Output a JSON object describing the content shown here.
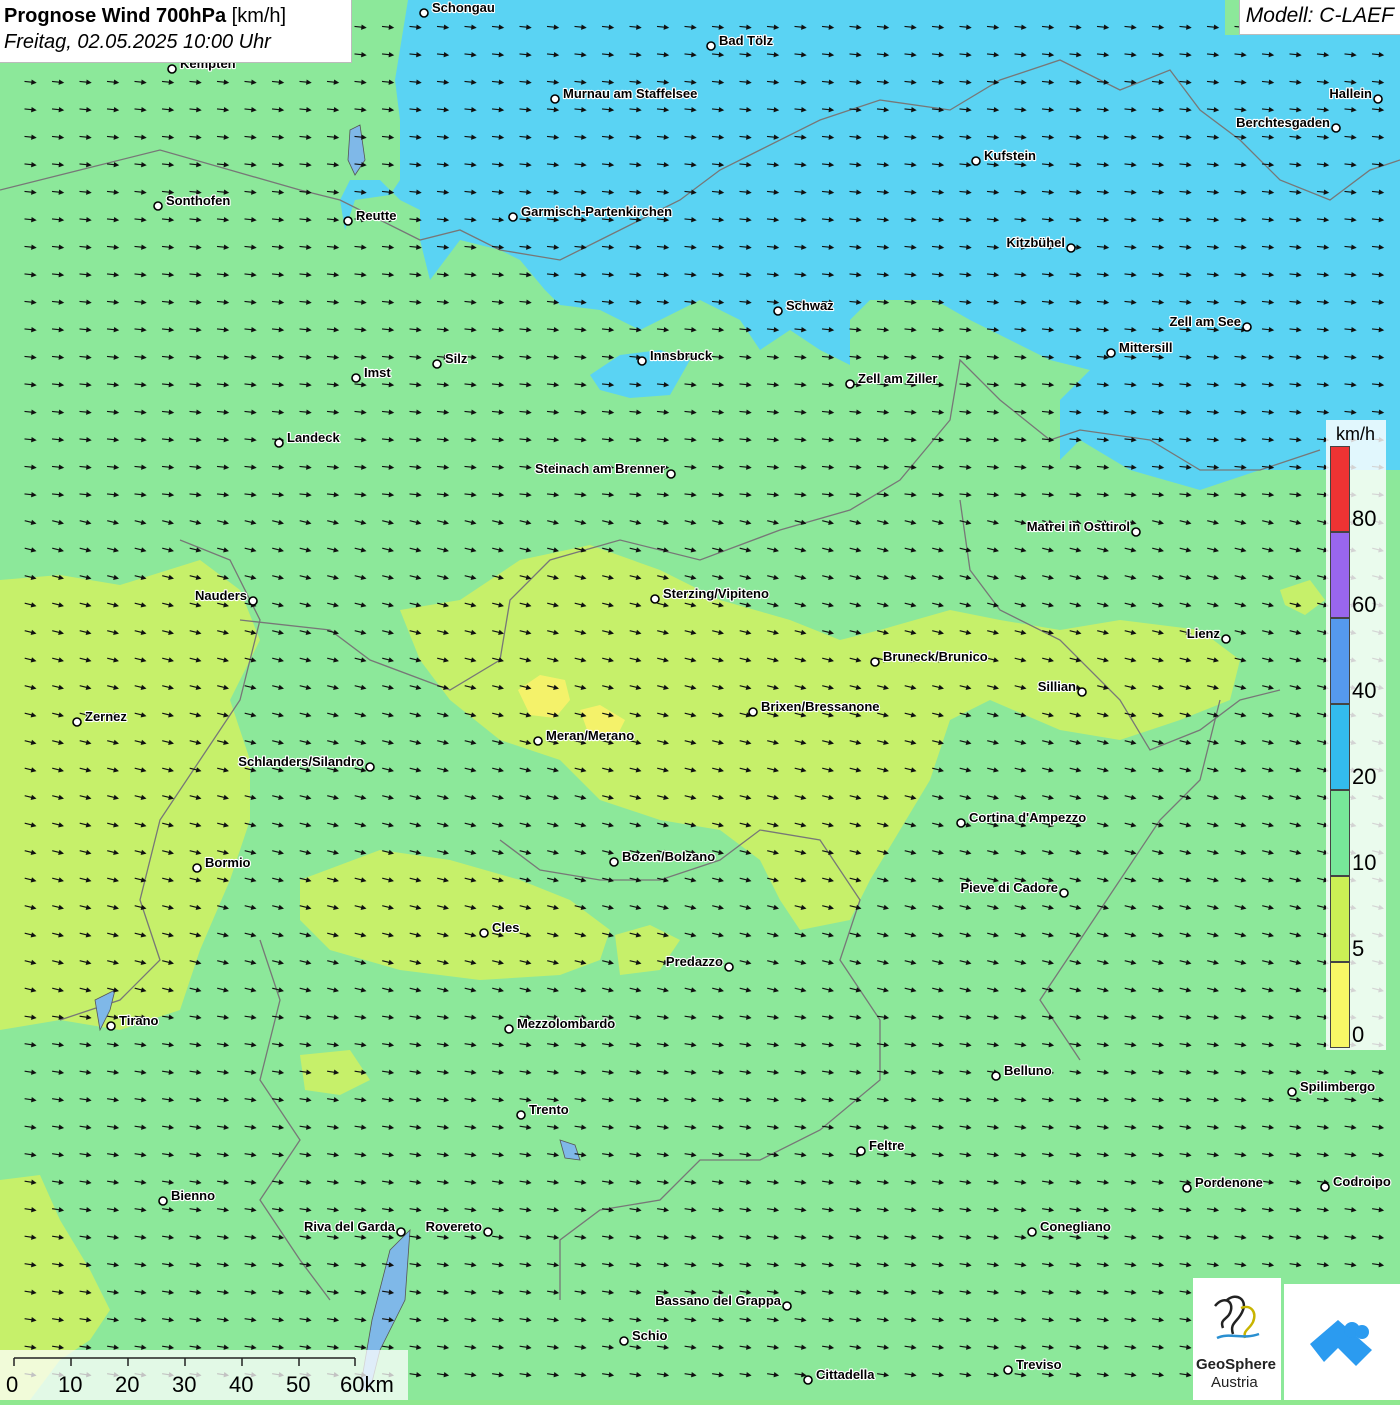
{
  "header": {
    "title_bold": "Prognose Wind 700hPa",
    "title_unit": "[km/h]",
    "date": "Freitag, 02.05.2025 10:00 Uhr",
    "model": "Modell: C-LAEF"
  },
  "legend": {
    "unit": "km/h",
    "levels": [
      {
        "label": "80",
        "color": "#ee3333"
      },
      {
        "label": "60",
        "color": "#9966ee"
      },
      {
        "label": "40",
        "color": "#5599ee"
      },
      {
        "label": "20",
        "color": "#33bbee"
      },
      {
        "label": "10",
        "color": "#77e899"
      },
      {
        "label": "5",
        "color": "#ccf055"
      },
      {
        "label": "0",
        "color": "#f8f866"
      }
    ]
  },
  "scale": {
    "labels": [
      "0",
      "10",
      "20",
      "30",
      "40",
      "50",
      "60km"
    ]
  },
  "logos": {
    "geosphere_line1": "GeoSphere",
    "geosphere_line2": "Austria"
  },
  "cities": [
    {
      "name": "Schongau"
    },
    {
      "name": "Kempten"
    },
    {
      "name": "Bad Tölz"
    },
    {
      "name": "Murnau am Staffelsee"
    },
    {
      "name": "Hallein"
    },
    {
      "name": "Berchtesgaden"
    },
    {
      "name": "Kufstein"
    },
    {
      "name": "Sonthofen"
    },
    {
      "name": "Reutte"
    },
    {
      "name": "Garmisch-Partenkirchen"
    },
    {
      "name": "Kitzbühel"
    },
    {
      "name": "Schwaz"
    },
    {
      "name": "Zell am See"
    },
    {
      "name": "Innsbruck"
    },
    {
      "name": "Mittersill"
    },
    {
      "name": "Silz"
    },
    {
      "name": "Imst"
    },
    {
      "name": "Zell am Ziller"
    },
    {
      "name": "Landeck"
    },
    {
      "name": "Steinach am Brenner"
    },
    {
      "name": "Matrei in Osttirol"
    },
    {
      "name": "Nauders"
    },
    {
      "name": "Sterzing/Vipiteno"
    },
    {
      "name": "Lienz"
    },
    {
      "name": "Bruneck/Brunico"
    },
    {
      "name": "Sillian"
    },
    {
      "name": "Zernez"
    },
    {
      "name": "Brixen/Bressanone"
    },
    {
      "name": "Meran/Merano"
    },
    {
      "name": "Schlanders/Silandro"
    },
    {
      "name": "Cortina d'Ampezzo"
    },
    {
      "name": "Bozen/Bolzano"
    },
    {
      "name": "Bormio"
    },
    {
      "name": "Pieve di Cadore"
    },
    {
      "name": "Cles"
    },
    {
      "name": "Predazzo"
    },
    {
      "name": "Tirano"
    },
    {
      "name": "Mezzolombardo"
    },
    {
      "name": "Belluno"
    },
    {
      "name": "Spilimbergo"
    },
    {
      "name": "Trento"
    },
    {
      "name": "Feltre"
    },
    {
      "name": "Pordenone"
    },
    {
      "name": "Codroipo"
    },
    {
      "name": "Bienno"
    },
    {
      "name": "Riva del Garda"
    },
    {
      "name": "Rovereto"
    },
    {
      "name": "Conegliano"
    },
    {
      "name": "Bassano del Grappa"
    },
    {
      "name": "Schio"
    },
    {
      "name": "Treviso"
    },
    {
      "name": "Cittadella"
    }
  ]
}
